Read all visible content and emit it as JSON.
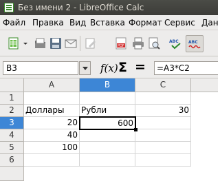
{
  "window": {
    "title": "Без имени 2 - LibreOffice Calc"
  },
  "menu": {
    "items": [
      "Файл",
      "Правка",
      "Вид",
      "Вставка",
      "Формат",
      "Сервис",
      "Дан"
    ]
  },
  "toolbar": {
    "icons": [
      "new-document-icon",
      "chevron-down-icon",
      "open-folder-icon",
      "save-icon",
      "email-icon",
      "edit-file-icon",
      "export-pdf-icon",
      "print-icon",
      "print-preview-icon",
      "spellcheck-icon",
      "autospellcheck-icon"
    ]
  },
  "formula_bar": {
    "name_box": "B3",
    "function_wizard": "f(x)",
    "sum_symbol": "Σ",
    "equals_symbol": "=",
    "formula": "=A3*C2"
  },
  "sheet": {
    "columns": [
      "A",
      "B",
      "C"
    ],
    "rows": [
      "1",
      "2",
      "3",
      "4",
      "5",
      "6"
    ],
    "cells": {
      "A2": "Доллары",
      "B2": "Рубли",
      "C2": "30",
      "A3": "20",
      "B3": "600",
      "A4": "40",
      "A5": "100"
    },
    "active_cell": "B3",
    "selection_color": "#3d86d6"
  }
}
